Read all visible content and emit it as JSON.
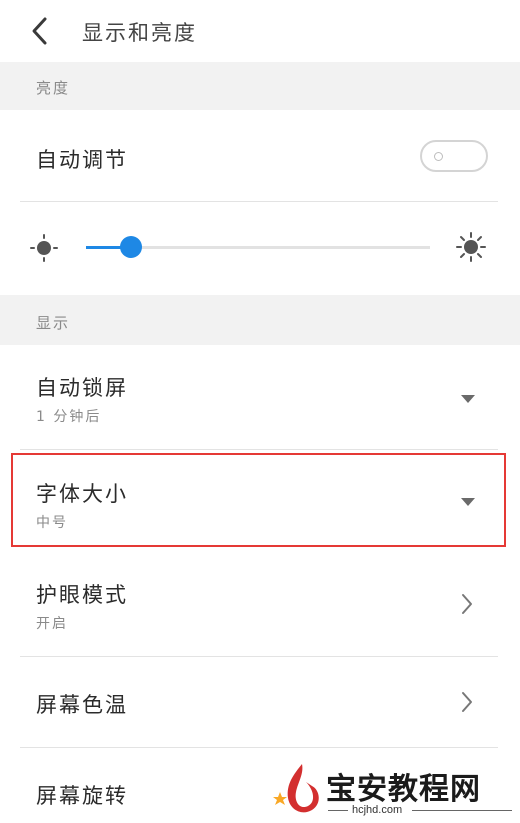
{
  "header": {
    "title": "显示和亮度",
    "back_icon": "chevron-left-icon"
  },
  "sections": {
    "brightness_label": "亮度",
    "display_label": "显示"
  },
  "brightness": {
    "auto_adjust_label": "自动调节",
    "auto_adjust_on": false,
    "level": 0.13,
    "low_icon": "sun-small-icon",
    "high_icon": "sun-large-icon",
    "accent_color": "#1e88e5"
  },
  "display": {
    "auto_lock": {
      "label": "自动锁屏",
      "value": "1 分钟后"
    },
    "font_size": {
      "label": "字体大小",
      "value": "中号"
    },
    "eye_protection": {
      "label": "护眼模式",
      "value": "开启"
    },
    "color_temperature": {
      "label": "屏幕色温"
    },
    "rotation": {
      "label": "屏幕旋转"
    }
  },
  "annotation": {
    "highlight_color": "#e53935"
  },
  "watermark": {
    "name": "宝安教程网",
    "url": "hcjhd.com"
  }
}
